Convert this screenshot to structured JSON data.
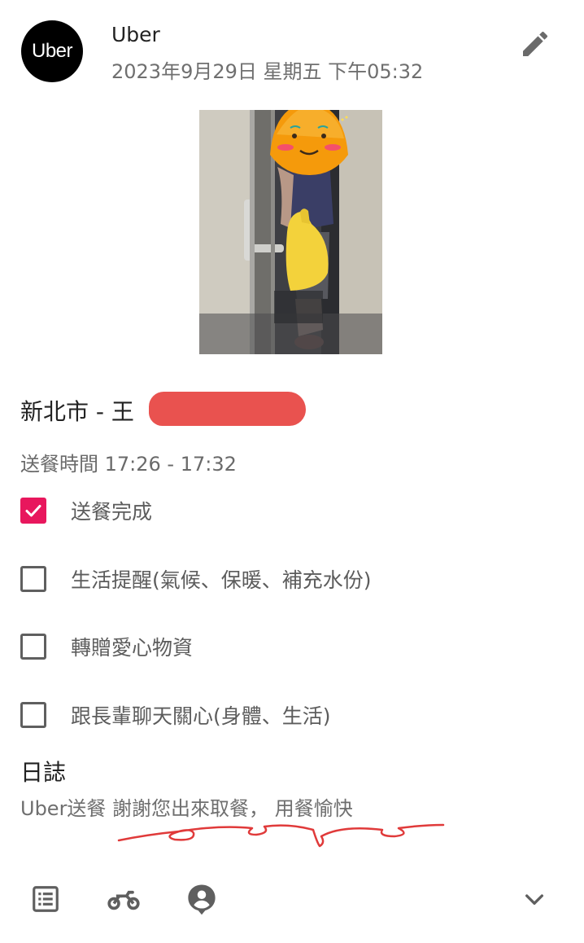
{
  "header": {
    "avatar_text": "Uber",
    "sender": "Uber",
    "timestamp": "2023年9月29日 星期五 下午05:32",
    "edit_icon": "pencil-icon"
  },
  "photo": {
    "description_icon": "photo",
    "emoji_sticker": "smiling-face-sticker"
  },
  "record": {
    "place": "新北市 - 王",
    "delivery_time": "送餐時間 17:26 - 17:32"
  },
  "checklist": [
    {
      "label": "送餐完成",
      "checked": true
    },
    {
      "label": "生活提醒(氣候、保暖、補充水份)",
      "checked": false
    },
    {
      "label": "轉贈愛心物資",
      "checked": false
    },
    {
      "label": "跟長輩聊天關心(身體、生活)",
      "checked": false
    }
  ],
  "journal": {
    "title": "日誌",
    "text": "Uber送餐 謝謝您出來取餐， 用餐愉快"
  },
  "bottom_bar": {
    "icons": [
      "list-icon",
      "motorcycle-icon",
      "person-pin-icon",
      "chevron-down-icon"
    ]
  },
  "colors": {
    "accent": "#e8175d",
    "redaction": "#e9524f",
    "scribble": "#e03a3a"
  }
}
